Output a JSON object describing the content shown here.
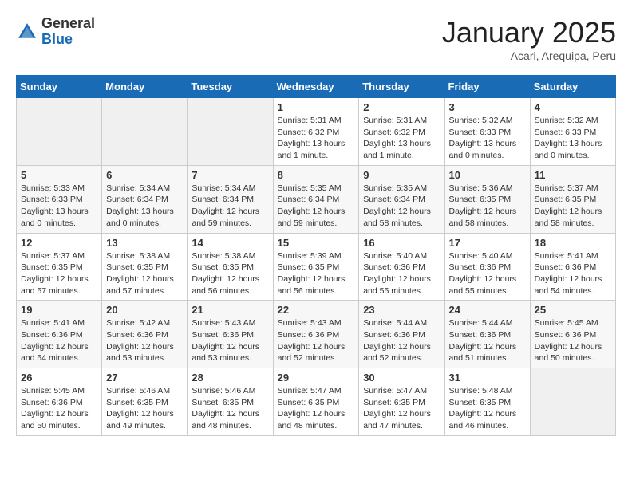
{
  "header": {
    "logo_general": "General",
    "logo_blue": "Blue",
    "month_title": "January 2025",
    "subtitle": "Acari, Arequipa, Peru"
  },
  "days_of_week": [
    "Sunday",
    "Monday",
    "Tuesday",
    "Wednesday",
    "Thursday",
    "Friday",
    "Saturday"
  ],
  "weeks": [
    [
      {
        "day": "",
        "info": ""
      },
      {
        "day": "",
        "info": ""
      },
      {
        "day": "",
        "info": ""
      },
      {
        "day": "1",
        "info": "Sunrise: 5:31 AM\nSunset: 6:32 PM\nDaylight: 13 hours\nand 1 minute."
      },
      {
        "day": "2",
        "info": "Sunrise: 5:31 AM\nSunset: 6:32 PM\nDaylight: 13 hours\nand 1 minute."
      },
      {
        "day": "3",
        "info": "Sunrise: 5:32 AM\nSunset: 6:33 PM\nDaylight: 13 hours\nand 0 minutes."
      },
      {
        "day": "4",
        "info": "Sunrise: 5:32 AM\nSunset: 6:33 PM\nDaylight: 13 hours\nand 0 minutes."
      }
    ],
    [
      {
        "day": "5",
        "info": "Sunrise: 5:33 AM\nSunset: 6:33 PM\nDaylight: 13 hours\nand 0 minutes."
      },
      {
        "day": "6",
        "info": "Sunrise: 5:34 AM\nSunset: 6:34 PM\nDaylight: 13 hours\nand 0 minutes."
      },
      {
        "day": "7",
        "info": "Sunrise: 5:34 AM\nSunset: 6:34 PM\nDaylight: 12 hours\nand 59 minutes."
      },
      {
        "day": "8",
        "info": "Sunrise: 5:35 AM\nSunset: 6:34 PM\nDaylight: 12 hours\nand 59 minutes."
      },
      {
        "day": "9",
        "info": "Sunrise: 5:35 AM\nSunset: 6:34 PM\nDaylight: 12 hours\nand 58 minutes."
      },
      {
        "day": "10",
        "info": "Sunrise: 5:36 AM\nSunset: 6:35 PM\nDaylight: 12 hours\nand 58 minutes."
      },
      {
        "day": "11",
        "info": "Sunrise: 5:37 AM\nSunset: 6:35 PM\nDaylight: 12 hours\nand 58 minutes."
      }
    ],
    [
      {
        "day": "12",
        "info": "Sunrise: 5:37 AM\nSunset: 6:35 PM\nDaylight: 12 hours\nand 57 minutes."
      },
      {
        "day": "13",
        "info": "Sunrise: 5:38 AM\nSunset: 6:35 PM\nDaylight: 12 hours\nand 57 minutes."
      },
      {
        "day": "14",
        "info": "Sunrise: 5:38 AM\nSunset: 6:35 PM\nDaylight: 12 hours\nand 56 minutes."
      },
      {
        "day": "15",
        "info": "Sunrise: 5:39 AM\nSunset: 6:35 PM\nDaylight: 12 hours\nand 56 minutes."
      },
      {
        "day": "16",
        "info": "Sunrise: 5:40 AM\nSunset: 6:36 PM\nDaylight: 12 hours\nand 55 minutes."
      },
      {
        "day": "17",
        "info": "Sunrise: 5:40 AM\nSunset: 6:36 PM\nDaylight: 12 hours\nand 55 minutes."
      },
      {
        "day": "18",
        "info": "Sunrise: 5:41 AM\nSunset: 6:36 PM\nDaylight: 12 hours\nand 54 minutes."
      }
    ],
    [
      {
        "day": "19",
        "info": "Sunrise: 5:41 AM\nSunset: 6:36 PM\nDaylight: 12 hours\nand 54 minutes."
      },
      {
        "day": "20",
        "info": "Sunrise: 5:42 AM\nSunset: 6:36 PM\nDaylight: 12 hours\nand 53 minutes."
      },
      {
        "day": "21",
        "info": "Sunrise: 5:43 AM\nSunset: 6:36 PM\nDaylight: 12 hours\nand 53 minutes."
      },
      {
        "day": "22",
        "info": "Sunrise: 5:43 AM\nSunset: 6:36 PM\nDaylight: 12 hours\nand 52 minutes."
      },
      {
        "day": "23",
        "info": "Sunrise: 5:44 AM\nSunset: 6:36 PM\nDaylight: 12 hours\nand 52 minutes."
      },
      {
        "day": "24",
        "info": "Sunrise: 5:44 AM\nSunset: 6:36 PM\nDaylight: 12 hours\nand 51 minutes."
      },
      {
        "day": "25",
        "info": "Sunrise: 5:45 AM\nSunset: 6:36 PM\nDaylight: 12 hours\nand 50 minutes."
      }
    ],
    [
      {
        "day": "26",
        "info": "Sunrise: 5:45 AM\nSunset: 6:36 PM\nDaylight: 12 hours\nand 50 minutes."
      },
      {
        "day": "27",
        "info": "Sunrise: 5:46 AM\nSunset: 6:35 PM\nDaylight: 12 hours\nand 49 minutes."
      },
      {
        "day": "28",
        "info": "Sunrise: 5:46 AM\nSunset: 6:35 PM\nDaylight: 12 hours\nand 48 minutes."
      },
      {
        "day": "29",
        "info": "Sunrise: 5:47 AM\nSunset: 6:35 PM\nDaylight: 12 hours\nand 48 minutes."
      },
      {
        "day": "30",
        "info": "Sunrise: 5:47 AM\nSunset: 6:35 PM\nDaylight: 12 hours\nand 47 minutes."
      },
      {
        "day": "31",
        "info": "Sunrise: 5:48 AM\nSunset: 6:35 PM\nDaylight: 12 hours\nand 46 minutes."
      },
      {
        "day": "",
        "info": ""
      }
    ]
  ]
}
